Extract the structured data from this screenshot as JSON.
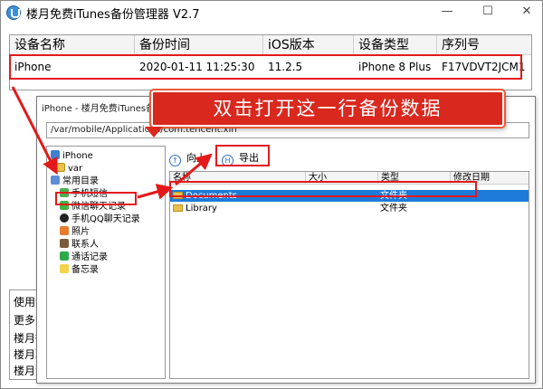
{
  "main_window": {
    "title": "楼月免费iTunes备份管理器 V2.7",
    "minimize": "—",
    "maximize": "☐",
    "close": "✕",
    "table": {
      "headers": [
        "设备名称",
        "备份时间",
        "iOS版本",
        "设备类型",
        "序列号"
      ],
      "row": [
        "iPhone",
        "2020-01-11  11:25:30",
        "11.2.5",
        "iPhone 8 Plus",
        "F17VDVT2JCM1"
      ]
    },
    "bottom_lines": [
      "使用说",
      "更多免",
      "楼月微",
      "楼月聊",
      "楼月免"
    ]
  },
  "callout": {
    "text": "双击打开这一行备份数据"
  },
  "child_window": {
    "title": "iPhone - 楼月免费iTunes备份管理器",
    "path": "/var/mobile/Applications/com.tencent.xin",
    "toolbar": {
      "up_label": "向上",
      "export_label": "导出"
    },
    "tree": {
      "root": "iPhone",
      "var": "var",
      "common": "常用目录",
      "items": [
        "手机短信",
        "微信聊天记录",
        "手机QQ聊天记录",
        "照片",
        "联系人",
        "通话记录",
        "备忘录"
      ]
    },
    "list": {
      "headers": [
        "名称",
        "大小",
        "类型",
        "修改日期"
      ],
      "rows": [
        {
          "name": "Documents",
          "size": "",
          "type": "文件夹",
          "date": ""
        },
        {
          "name": "Library",
          "size": "",
          "type": "文件夹",
          "date": ""
        }
      ]
    }
  },
  "colors": {
    "annotation_red": "#e21a1a",
    "callout_bg": "#d9281e",
    "selection_blue": "#1e7ad8",
    "accent_blue": "#2a6fc9"
  }
}
